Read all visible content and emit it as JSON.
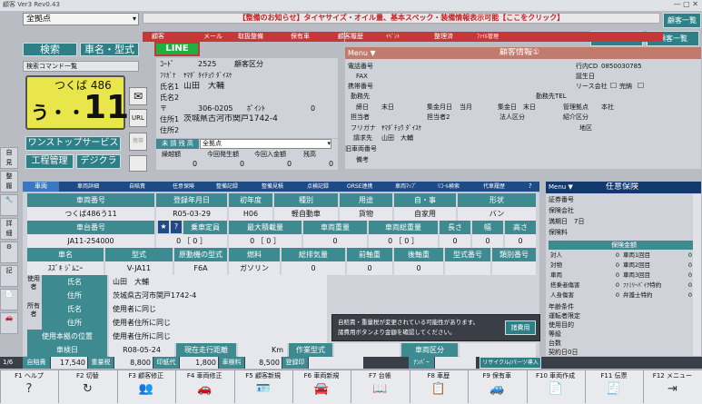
{
  "title": "顧客 Ver3 Rev0.43",
  "store": "全拠点",
  "notice": "【整備のお知らせ】タイヤサイズ・オイル量、基本スペック・装備情報表示可能【ここをクリック】",
  "right_buttons": {
    "vehicle_list": "顧客一覧",
    "reg_vehicle": "登録時情報なし車両",
    "customer_list": "顧客一覧"
  },
  "left_buttons": {
    "search": "検索",
    "name_type": "車名・型式",
    "command": "検索コマンド一覧"
  },
  "plate": {
    "region": "つくば 486",
    "kana": "う・・",
    "number": "11"
  },
  "plate_side": {
    "mail": "✉",
    "url": "URL",
    "btn3": "携帯"
  },
  "oneshop": "ワンストップサービス",
  "kotei": "工程管理",
  "digikura": "デジクラ",
  "cust_tabs": [
    "顧客",
    "メール",
    "取扱整備",
    "保有車",
    "顧客履歴",
    "ｲﾍﾞﾝﾄ",
    "整理済",
    "ﾌｧｲﾙ管理"
  ],
  "line_label": "LINE",
  "cust": {
    "code_label": "ｺｰﾄﾞ",
    "code": "2525",
    "kubun_label": "顧客区分",
    "furigana_label": "ﾌﾘｶﾞﾅ",
    "furigana": "ﾔﾏﾀﾞ ﾀｲﾁｮｳ ﾀﾞｲｽｹ",
    "name_label": "氏名1",
    "name": "山田　大輔",
    "name2_label": "氏名2",
    "zip_label": "〒",
    "zip": "306-0205",
    "point_label": "ﾎﾟｲﾝﾄ",
    "point": "0",
    "addr_label": "住所1",
    "addr": "茨城県古河市関戸1742-4",
    "addr2_label": "住所2"
  },
  "balance": {
    "tab1": "未",
    "tab2": "請",
    "tab3": "残",
    "tab4": "高",
    "store_label": "全拠点",
    "cols": [
      "繰越額",
      "今回発生額",
      "今回入金額",
      "残高"
    ],
    "vals": [
      "0",
      "0",
      "0",
      "0"
    ]
  },
  "info": {
    "menu": "Menu ▼",
    "title": "顧客情報①",
    "tel_label": "電話番号",
    "fax_label": "FAX",
    "mobile_label": "携帯番号",
    "work_label": "勤務先",
    "work_tel_label": "勤務先TEL",
    "shime_label": "締日",
    "shime": "末日",
    "kaishu_label": "集金月日",
    "kaishu": "当月",
    "shukin_label": "集金日",
    "shukin": "末日",
    "eigyo_label": "管理拠点",
    "eigyo": "本社",
    "tanto_label": "担当者",
    "tanto2_label": "担当者2",
    "hojin_label": "法人区分",
    "shokai_label": "紹介区分",
    "furi_label": "フリガナ",
    "furi": "ﾔﾏﾀﾞﾁｮｳ ﾀﾞｲｽｹ",
    "chiiki_label": "地区",
    "seikyu_label": "請求先",
    "seikyu": "山田　大輔",
    "kyusha_label": "旧車両番号",
    "biko_label": "備考",
    "inquiry_label": "行内CD",
    "inquiry": "0850030785",
    "birthday_label": "誕生日",
    "lease_label": "リース会社",
    "kanryo_label": "完納"
  },
  "veh_tabs": [
    "車両",
    "車両詳細",
    "自賠責",
    "任意保険",
    "整備記録",
    "整備見積",
    "点検記録",
    "ORSE連携",
    "車両ﾏｯﾌﾟ",
    "ﾘｺｰﾙ検索",
    "代車履歴",
    "?"
  ],
  "veh": {
    "r1l": [
      "車両番号",
      "登録年月日",
      "初年度",
      "種別",
      "用途",
      "自・事",
      "形状"
    ],
    "r1v": [
      "つくば486う11",
      "R05-03-29",
      "H06",
      "軽自動車",
      "貨物",
      "自家用",
      "バン"
    ],
    "r2l": [
      "車台番号",
      "",
      "乗車定員",
      "最大積載量",
      "車両重量",
      "車両総重量",
      "長さ",
      "幅",
      "高さ"
    ],
    "r2v": [
      "JA11-254000",
      "0 ［ 0 ］",
      "0 ［ 0 ］",
      "0",
      "0 ［ 0 ］",
      "0",
      "0",
      "0",
      "0"
    ],
    "r3l": [
      "車名",
      "型式",
      "原動機の型式",
      "燃料",
      "総排気量",
      "前軸重",
      "後軸重",
      "型式番号",
      "類別番号"
    ],
    "r3v": [
      "ｽｽﾞｷ ｼﾞﾑﾆｰ",
      "V-JA11",
      "F6A",
      "ガソリン",
      "0",
      "0",
      "0",
      "",
      ""
    ],
    "owner_lbl": "使用者",
    "owner_name_label": "氏名",
    "owner_name": "山田　大輔",
    "owner_addr_label": "住所",
    "owner_addr": "茨城県古河市関戸1742-4",
    "user_lbl": "所有者",
    "user_name_label": "氏名",
    "user_name": "使用者に同じ",
    "user_addr_label": "住所",
    "user_addr": "使用者住所に同じ",
    "base_label": "使用本拠の位置",
    "base": "使用者住所に同じ",
    "shaken_label": "車検日",
    "shaken": "R08-05-24",
    "kyori_label": "現在走行距離",
    "km": "Km",
    "sagyo_label": "作業型式",
    "kubun_label": "車両区分"
  },
  "popup": {
    "text1": "自賠責・重量税が変更されている可能性があります。",
    "text2": "諸費用ボタンより金額を確認してください。",
    "btn": "諸費用"
  },
  "summary": {
    "jibai_l": "自賠責",
    "jibai": "17,540",
    "jyuryo_l": "重量税",
    "jyuryo": "8,800",
    "inshi_l": "印紙代",
    "inshi": "1,800",
    "hoken_l": "車検料",
    "hoken": "8,500",
    "reg_l": "登録印",
    "number_l": "ﾅﾝﾊﾞｰ",
    "lease_btn": "リサイクル/パーツ導入"
  },
  "page_ind": "1/6",
  "insurance": {
    "menu": "Menu ▼",
    "title": "任意保険",
    "rows": [
      "証券番号",
      "保険会社",
      "満期日　7日",
      "保険料",
      "保険金額"
    ],
    "sub": [
      [
        "対人",
        "0",
        "車両1回目",
        "0"
      ],
      [
        "対物",
        "0",
        "車両2回目",
        "0"
      ],
      [
        "車両",
        "0",
        "車両3回目",
        "0"
      ],
      [
        "搭乗者傷害",
        "0",
        "ﾌｧﾐﾘｰﾊﾞｲｸ特約",
        "0"
      ],
      [
        "人身傷害",
        "0",
        "弁護士特約",
        "0"
      ]
    ],
    "more": [
      "年齢条件",
      "運転者限定",
      "使用目的",
      "等級",
      "台数",
      "契約日0日"
    ]
  },
  "fkeys": [
    [
      "F1 ヘルプ",
      "?"
    ],
    [
      "F2 切替",
      "↻"
    ],
    [
      "F3 顧客修正",
      "👥"
    ],
    [
      "F4 車両修正",
      "🚗"
    ],
    [
      "F5 顧客新規",
      "🪪"
    ],
    [
      "F6 車両新規",
      "🚘"
    ],
    [
      "F7 台帳",
      "📖"
    ],
    [
      "F8 車歴",
      "📋"
    ],
    [
      "F9 保有車",
      "🚙"
    ],
    [
      "F10 車両作成",
      "📄"
    ],
    [
      "F11 伝票",
      "🧾"
    ],
    [
      "F12 メニュー",
      "⇥"
    ]
  ],
  "side_icons": [
    "見積書",
    "",
    "詳細",
    "",
    "記録",
    "",
    "",
    "",
    "",
    ""
  ]
}
